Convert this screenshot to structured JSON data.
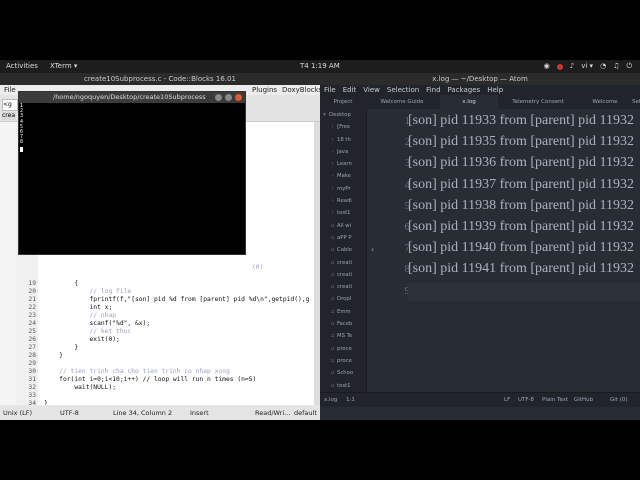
{
  "topbar": {
    "activities": "Activities",
    "app": "XTerm ▾",
    "clock": "T4  1:19 AM",
    "lang": "vi ▾"
  },
  "codeblocks": {
    "title": "create10Subprocess.c - Code::Blocks 16.01",
    "menu_left": "File",
    "menu_plugins": "Plugins",
    "menu_doxy": "DoxyBlocks",
    "field1": "<g",
    "field2": "crea",
    "lines": [
      {
        "n": "19",
        "t": "        {"
      },
      {
        "n": "20",
        "t": "            // log file"
      },
      {
        "n": "21",
        "t": "            fprintf(f,\"[son] pid %d from [parent] pid %d\\n\",getpid(),g"
      },
      {
        "n": "22",
        "t": "            int x;"
      },
      {
        "n": "23",
        "t": "            // nhap"
      },
      {
        "n": "24",
        "t": "            scanf(\"%d\", &x);"
      },
      {
        "n": "25",
        "t": "            // ket thuc"
      },
      {
        "n": "26",
        "t": "            exit(0);"
      },
      {
        "n": "27",
        "t": "        }"
      },
      {
        "n": "28",
        "t": "    }"
      },
      {
        "n": "29",
        "t": ""
      },
      {
        "n": "30",
        "t": "    // tien trinh cha cho tien trinh co nhap xong"
      },
      {
        "n": "31",
        "t": "    for(int i=0;i<10;i++) // loop will run n times (n=5)"
      },
      {
        "n": "32",
        "t": "        wait(NULL);"
      },
      {
        "n": "33",
        "t": ""
      },
      {
        "n": "34",
        "t": "}"
      },
      {
        "n": "35",
        "t": ""
      },
      {
        "n": "36",
        "t": ""
      }
    ],
    "hidden_fragment": "(0)",
    "status": {
      "eol": "Unix (LF)",
      "enc": "UTF-8",
      "pos": "Line 34, Column 2",
      "mode": "Insert",
      "rw": "Read/Wri...",
      "prof": "default"
    }
  },
  "xterm": {
    "title": "/home/ngoquyen/Desktop/create10Subprocess",
    "nums": [
      "1",
      "2",
      "3",
      "4",
      "5",
      "6",
      "7",
      "8"
    ]
  },
  "atom": {
    "title": "x.log — ~/Desktop — Atom",
    "menu": [
      "File",
      "Edit",
      "View",
      "Selection",
      "Find",
      "Packages",
      "Help"
    ],
    "tabs": [
      "Project",
      "Welcome Guide",
      "x.log",
      "Telemetry Consent",
      "Welcome",
      "Settings"
    ],
    "tree_root": "Desktop",
    "tree": [
      "[Free",
      "18 th",
      "Java",
      "Learn",
      "Make",
      "myPr",
      "Readi",
      "test1",
      "All wi",
      "aPP P",
      "Cable",
      "creati",
      "creati",
      "creati",
      "Dropl",
      "Emm",
      "Faceb",
      "MS Te",
      "proce",
      "proce",
      "Schoo",
      "test1",
      "test1.",
      "test1",
      "test2"
    ],
    "lines": [
      "[son] pid 11933 from [parent] pid 11932",
      "[son] pid 11935 from [parent] pid 11932",
      "[son] pid 11936 from [parent] pid 11932",
      "[son] pid 11937 from [parent] pid 11932",
      "[son] pid 11938 from [parent] pid 11932",
      "[son] pid 11939 from [parent] pid 11932",
      "[son] pid 11940 from [parent] pid 11932",
      "[son] pid 11941 from [parent] pid 11932",
      ""
    ],
    "status": {
      "file": "x.log",
      "pos": "1:1",
      "eol": "LF",
      "enc": "UTF-8",
      "grammar": "Plain Text",
      "github": "GitHub",
      "git": "Git (0)"
    }
  },
  "colors": {
    "atom_bg": "#282c34",
    "xterm_bg": "#000000",
    "close": "#e05a2b"
  }
}
